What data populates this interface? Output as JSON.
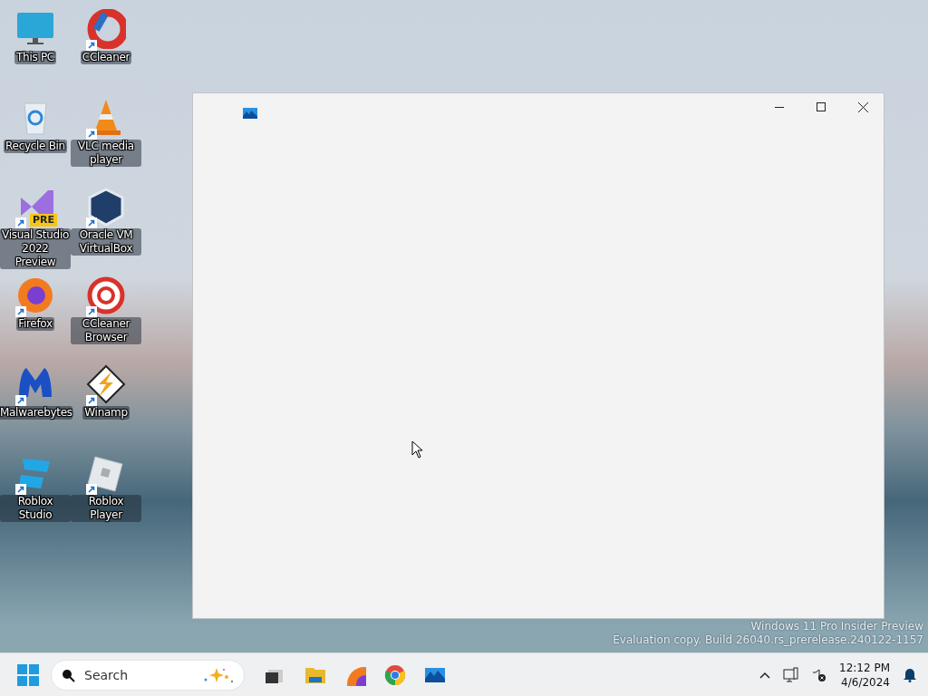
{
  "desktop": {
    "icons": [
      {
        "label": "This PC",
        "kind": "monitor",
        "shortcut": false
      },
      {
        "label": "CCleaner",
        "kind": "cleaner",
        "shortcut": true
      },
      {
        "label": "Recycle Bin",
        "kind": "bin",
        "shortcut": false
      },
      {
        "label": "VLC media player",
        "kind": "cone",
        "shortcut": true
      },
      {
        "label": "Visual Studio 2022 Preview",
        "kind": "studio",
        "badge": "PRE",
        "shortcut": true
      },
      {
        "label": "Oracle VM VirtualBox",
        "kind": "cube",
        "shortcut": true
      },
      {
        "label": "Firefox",
        "kind": "fox",
        "shortcut": true
      },
      {
        "label": "CCleaner Browser",
        "kind": "ring",
        "shortcut": true
      },
      {
        "label": "Malwarebytes",
        "kind": "shield",
        "shortcut": true
      },
      {
        "label": "Winamp",
        "kind": "bolt",
        "shortcut": true
      },
      {
        "label": "Roblox Studio",
        "kind": "blocks",
        "shortcut": true
      },
      {
        "label": "Roblox Player",
        "kind": "tile",
        "shortcut": true
      }
    ]
  },
  "watermark": [
    "Windows 11 Pro Insider Preview",
    "Evaluation copy. Build 26040.rs_prerelease.240122-1157"
  ],
  "taskbar": {
    "search": {
      "placeholder": "Search"
    },
    "apps": [
      {
        "kind": "taskview"
      },
      {
        "kind": "folder"
      },
      {
        "kind": "fox"
      },
      {
        "kind": "chrome"
      },
      {
        "kind": "photos"
      }
    ],
    "clock": {
      "time": "12:12 PM",
      "date": "4/6/2024"
    }
  }
}
